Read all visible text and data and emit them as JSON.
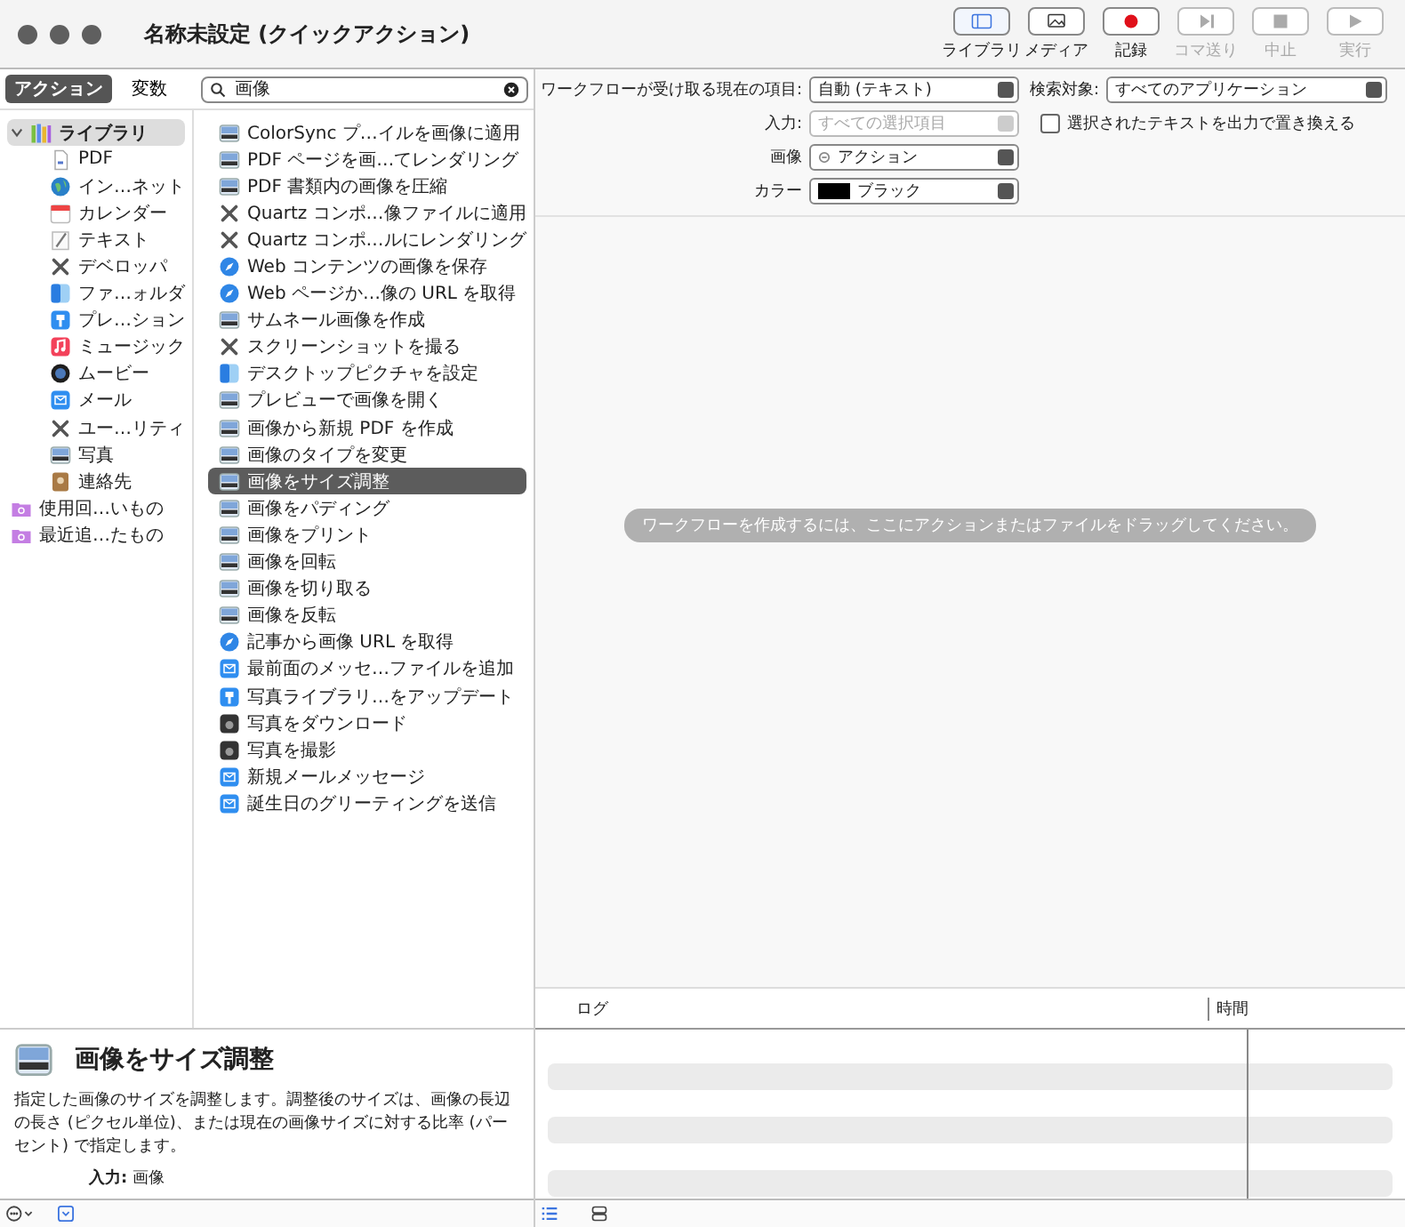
{
  "window": {
    "title": "名称未設定 (クイックアクション)"
  },
  "toolbar": [
    {
      "label": "ライブラリ",
      "kind": "sidebar",
      "on": true,
      "disabled": false
    },
    {
      "label": "メディア",
      "kind": "photo",
      "on": false,
      "disabled": false
    },
    {
      "label": "記録",
      "kind": "record",
      "on": false,
      "disabled": false
    },
    {
      "label": "コマ送り",
      "kind": "step",
      "on": false,
      "disabled": true
    },
    {
      "label": "中止",
      "kind": "stop",
      "on": false,
      "disabled": true
    },
    {
      "label": "実行",
      "kind": "play",
      "on": false,
      "disabled": true
    }
  ],
  "tabs": [
    {
      "label": "アクション",
      "selected": true
    },
    {
      "label": "変数",
      "selected": false
    }
  ],
  "search": {
    "value": "画像"
  },
  "library": [
    {
      "label": "ライブラリ",
      "kind": "books",
      "expanded": true,
      "selected": true,
      "children": [
        {
          "label": "PDF",
          "kind": "doc",
          "selected": false
        },
        {
          "label": "イン…ネット",
          "kind": "globe",
          "selected": false
        },
        {
          "label": "カレンダー",
          "kind": "calendar",
          "selected": false
        },
        {
          "label": "テキスト",
          "kind": "notepad",
          "selected": false
        },
        {
          "label": "デベロッパ",
          "kind": "tools",
          "selected": false
        },
        {
          "label": "ファ…ォルダ",
          "kind": "finder",
          "selected": false
        },
        {
          "label": "プレ…ション",
          "kind": "podium",
          "selected": false
        },
        {
          "label": "ミュージック",
          "kind": "music",
          "selected": false
        },
        {
          "label": "ムービー",
          "kind": "lens",
          "selected": false
        },
        {
          "label": "メール",
          "kind": "mail",
          "selected": false
        },
        {
          "label": "ユー…リティ",
          "kind": "tools",
          "selected": false
        },
        {
          "label": "写真",
          "kind": "image",
          "selected": false
        },
        {
          "label": "連絡先",
          "kind": "contacts",
          "selected": false
        }
      ]
    },
    {
      "label": "使用回…いもの",
      "kind": "folder",
      "selected": false
    },
    {
      "label": "最近追…たもの",
      "kind": "folder",
      "selected": false
    }
  ],
  "actions": [
    {
      "label": "ColorSync プ…イルを画像に適用",
      "kind": "image",
      "selected": false
    },
    {
      "label": "PDF ページを画…てレンダリング",
      "kind": "image",
      "selected": false
    },
    {
      "label": "PDF 書類内の画像を圧縮",
      "kind": "image",
      "selected": false
    },
    {
      "label": "Quartz コンポ…像ファイルに適用",
      "kind": "tools",
      "selected": false
    },
    {
      "label": "Quartz コンポ…ルにレンダリング",
      "kind": "tools",
      "selected": false
    },
    {
      "label": "Web コンテンツの画像を保存",
      "kind": "compass",
      "selected": false
    },
    {
      "label": "Web ページか…像の URL を取得",
      "kind": "compass",
      "selected": false
    },
    {
      "label": "サムネール画像を作成",
      "kind": "image",
      "selected": false
    },
    {
      "label": "スクリーンショットを撮る",
      "kind": "tools",
      "selected": false
    },
    {
      "label": "デスクトップピクチャを設定",
      "kind": "finder",
      "selected": false
    },
    {
      "label": "プレビューで画像を開く",
      "kind": "image",
      "selected": false
    },
    {
      "label": "画像から新規 PDF を作成",
      "kind": "image",
      "selected": false
    },
    {
      "label": "画像のタイプを変更",
      "kind": "image",
      "selected": false
    },
    {
      "label": "画像をサイズ調整",
      "kind": "image",
      "selected": true
    },
    {
      "label": "画像をパディング",
      "kind": "image",
      "selected": false
    },
    {
      "label": "画像をプリント",
      "kind": "image",
      "selected": false
    },
    {
      "label": "画像を回転",
      "kind": "image",
      "selected": false
    },
    {
      "label": "画像を切り取る",
      "kind": "image",
      "selected": false
    },
    {
      "label": "画像を反転",
      "kind": "image",
      "selected": false
    },
    {
      "label": "記事から画像 URL を取得",
      "kind": "compass",
      "selected": false
    },
    {
      "label": "最前面のメッセ…ファイルを追加",
      "kind": "mail",
      "selected": false
    },
    {
      "label": "写真ライブラリ…をアップデート",
      "kind": "podium",
      "selected": false
    },
    {
      "label": "写真をダウンロード",
      "kind": "camera",
      "selected": false
    },
    {
      "label": "写真を撮影",
      "kind": "camera",
      "selected": false
    },
    {
      "label": "新規メールメッセージ",
      "kind": "mail",
      "selected": false
    },
    {
      "label": "誕生日のグリーティングを送信",
      "kind": "mail",
      "selected": false
    }
  ],
  "description": {
    "title": "画像をサイズ調整",
    "body": "指定した画像のサイズを調整します。調整後のサイズは、画像の長辺の長さ (ピクセル単位)、または現在の画像サイズに対する比率 (パーセント) で指定します。",
    "input_label": "入力:",
    "input_value": "画像"
  },
  "settings": {
    "receives_label": "ワークフローが受け取る現在の項目:",
    "receives_value": "自動 (テキスト)",
    "target_label": "検索対象:",
    "target_value": "すべてのアプリケーション",
    "input_label": "入力:",
    "input_value": "すべての選択項目",
    "input_disabled": true,
    "replace_label": "選択されたテキストを出力で置き換える",
    "replace_checked": false,
    "image_label": "画像",
    "image_value": "アクション",
    "color_label": "カラー",
    "color_value": "ブラック",
    "color": "#000000"
  },
  "canvas": {
    "hint": "ワークフローを作成するには、ここにアクションまたはファイルをドラッグしてください。"
  },
  "log": {
    "columns": [
      "ログ",
      "時間"
    ]
  }
}
